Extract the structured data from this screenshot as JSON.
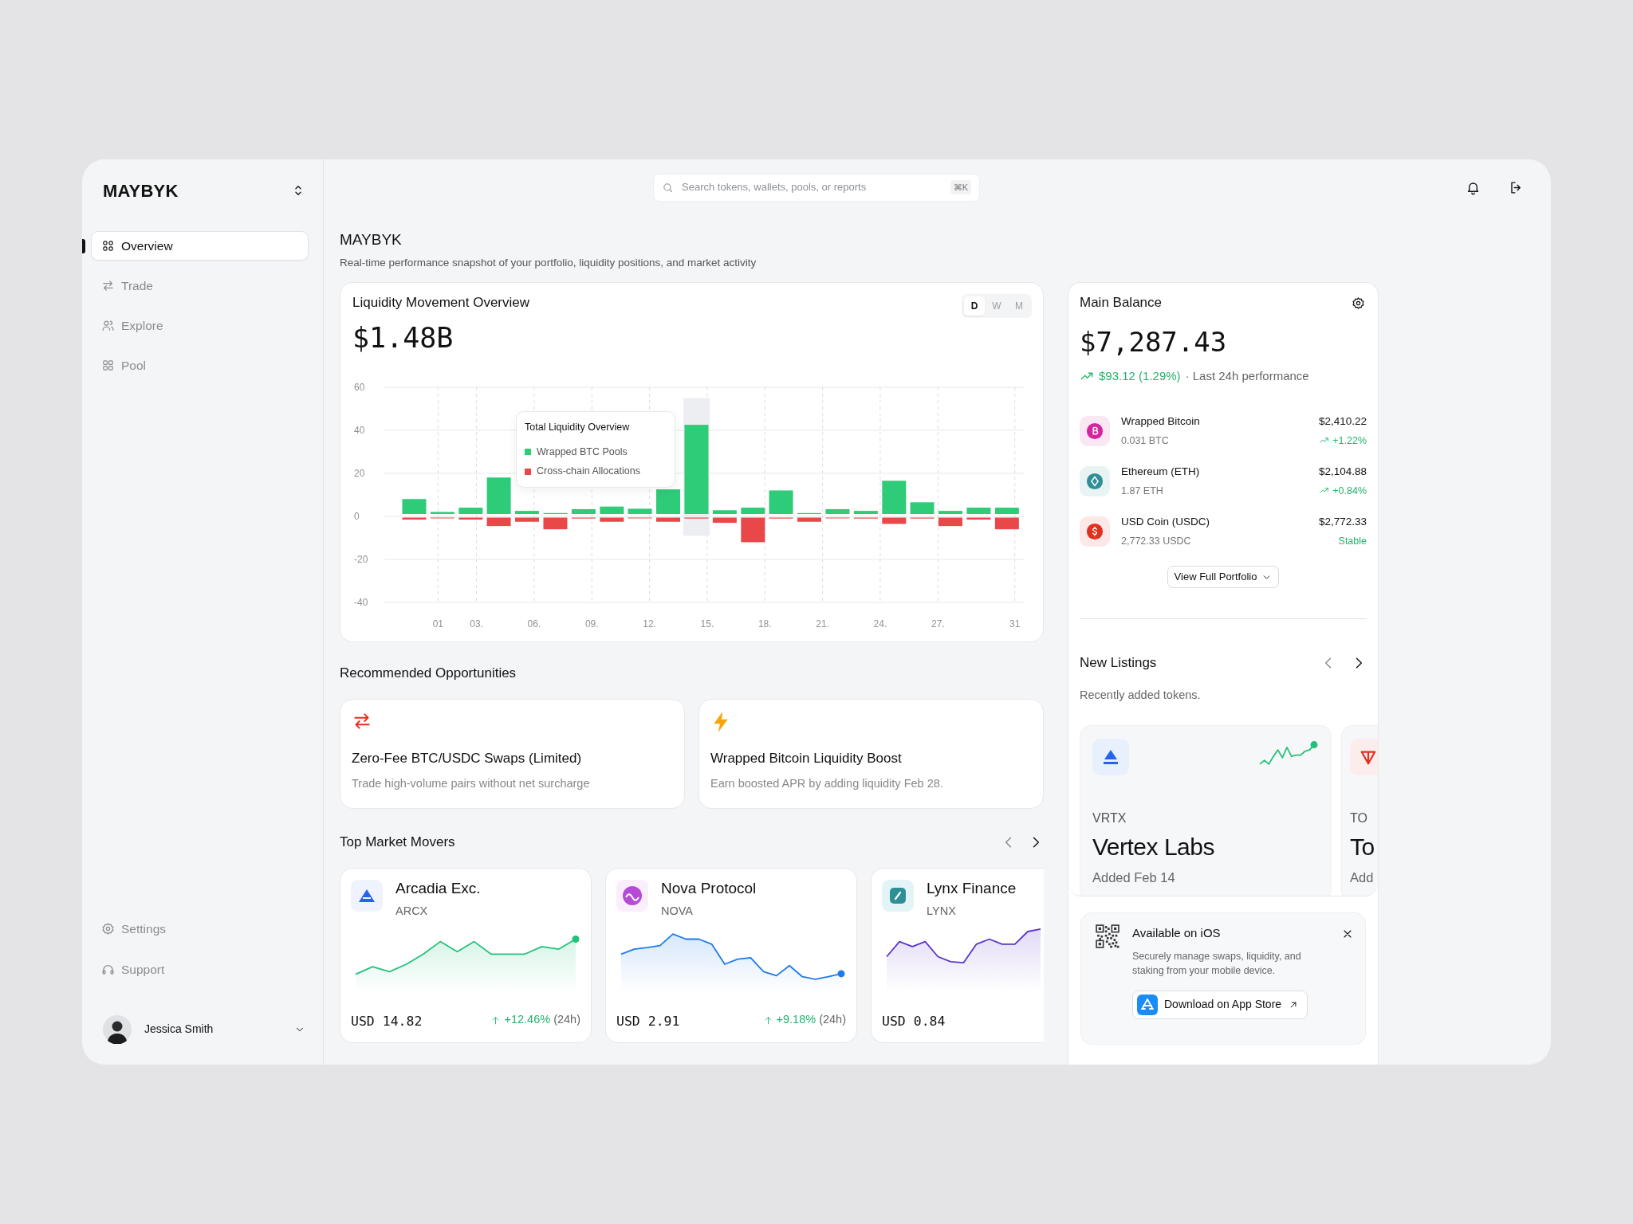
{
  "brand": {
    "name": "MAYBYK"
  },
  "nav": [
    {
      "label": "Overview",
      "selected": true
    },
    {
      "label": "Trade",
      "selected": false
    },
    {
      "label": "Explore",
      "selected": false
    },
    {
      "label": "Pool",
      "selected": false
    }
  ],
  "footer_nav": [
    {
      "label": "Settings"
    },
    {
      "label": "Support"
    }
  ],
  "user": {
    "name": "Jessica Smith"
  },
  "search": {
    "placeholder": "Search tokens, wallets, pools, or reports",
    "shortcut": "⌘K"
  },
  "page": {
    "title": "MAYBYK",
    "subtitle": "Real-time performance snapshot of your portfolio, liquidity positions, and market activity"
  },
  "liquidity": {
    "title": "Liquidity Movement Overview",
    "total": "$1.48B",
    "periods": [
      {
        "label": "D",
        "selected": true
      },
      {
        "label": "W",
        "selected": false
      },
      {
        "label": "M",
        "selected": false
      }
    ],
    "tooltip": {
      "title": "Total Liquidity Overview"
    },
    "chart_data": {
      "type": "bar",
      "stacked": true,
      "grid": true,
      "legend": true,
      "x": [
        -0.24,
        1.23,
        2.7,
        4.16,
        5.63,
        7.1,
        8.57,
        10.04,
        11.5,
        12.97,
        14.44,
        15.91,
        17.38,
        18.84,
        20.31,
        21.78,
        23.25,
        24.72,
        26.18,
        27.65,
        29.12,
        30.59
      ],
      "xlim": [
        -1.8,
        31.5
      ],
      "ylim": [
        -40,
        60
      ],
      "yticks": [
        -40,
        -20,
        0,
        20,
        40,
        60
      ],
      "xticks": [
        {
          "value": 1,
          "label": "01"
        },
        {
          "value": 3,
          "label": "03."
        },
        {
          "value": 6,
          "label": "06."
        },
        {
          "value": 9,
          "label": "09."
        },
        {
          "value": 12,
          "label": "12."
        },
        {
          "value": 15,
          "label": "15."
        },
        {
          "value": 18,
          "label": "18."
        },
        {
          "value": 21,
          "label": "21."
        },
        {
          "value": 24,
          "label": "24."
        },
        {
          "value": 27,
          "label": "27."
        },
        {
          "value": 31,
          "label": "31"
        }
      ],
      "series": [
        {
          "name": "Wrapped BTC Pools",
          "color": "#2ecb78",
          "values": [
            7.5,
            1.5,
            3.5,
            17.5,
            2,
            1,
            2.8,
            4,
            3,
            12,
            42,
            2.3,
            3.5,
            11.5,
            1,
            2.8,
            2,
            16,
            6,
            2,
            3.5,
            3.5
          ]
        },
        {
          "name": "Cross-chain Allocations",
          "color": "#e84848",
          "values": [
            -1.5,
            -0.5,
            -1.5,
            -4.5,
            -2.5,
            -6,
            -1,
            -2.5,
            -0.5,
            -2.5,
            -1,
            -3,
            -12,
            -1,
            -2.5,
            -0.5,
            -1,
            -3.5,
            -1,
            -4.5,
            -1.5,
            -6
          ]
        }
      ]
    }
  },
  "opportunities": {
    "title": "Recommended Opportunities",
    "items": [
      {
        "title": "Zero-Fee BTC/USDC Swaps (Limited)",
        "text": "Trade high-volume pairs without net surcharge"
      },
      {
        "title": "Wrapped Bitcoin Liquidity Boost",
        "text": "Earn boosted APR by adding liquidity Feb 28."
      }
    ]
  },
  "movers": {
    "title": "Top Market Movers",
    "items": [
      {
        "name": "Arcadia Exc.",
        "symbol": "ARCX",
        "price": "USD 14.82",
        "change": "+12.46%",
        "period": "(24h)",
        "color": "#22c27a"
      },
      {
        "name": "Nova Protocol",
        "symbol": "NOVA",
        "price": "USD 2.91",
        "change": "+9.18%",
        "period": "(24h)",
        "color": "#1e7be8"
      },
      {
        "name": "Lynx Finance",
        "symbol": "LYNX",
        "price": "USD 0.84",
        "color": "#5b35c9"
      }
    ]
  },
  "balance": {
    "title": "Main Balance",
    "total": "$7,287.43",
    "change": "$93.12 (1.29%)",
    "note": "· Last 24h performance",
    "button": "View Full Portfolio",
    "assets": [
      {
        "name": "Wrapped Bitcoin",
        "amount": "0.031 BTC",
        "value": "$2,410.22",
        "change": "+1.22%",
        "kind": "gain",
        "color": "#d6249f"
      },
      {
        "name": "Ethereum (ETH)",
        "amount": "1.87 ETH",
        "value": "$2,104.88",
        "change": "+0.84%",
        "kind": "gain",
        "color": "#2f8f96"
      },
      {
        "name": "USD Coin (USDC)",
        "amount": "2,772.33 USDC",
        "value": "$2,772.33",
        "change": "Stable",
        "kind": "stable",
        "color": "#e0301e"
      }
    ]
  },
  "listings": {
    "title": "New Listings",
    "subtitle": "Recently added tokens.",
    "items": [
      {
        "symbol": "VRTX",
        "name": "Vertex Labs",
        "added": "Added Feb 14"
      },
      {
        "symbol": "TO",
        "name": "To",
        "added": "Add"
      }
    ]
  },
  "ios": {
    "title": "Available on iOS",
    "text": "Securely manage swaps, liquidity, and staking from your mobile device.",
    "button": "Download on App Store"
  }
}
